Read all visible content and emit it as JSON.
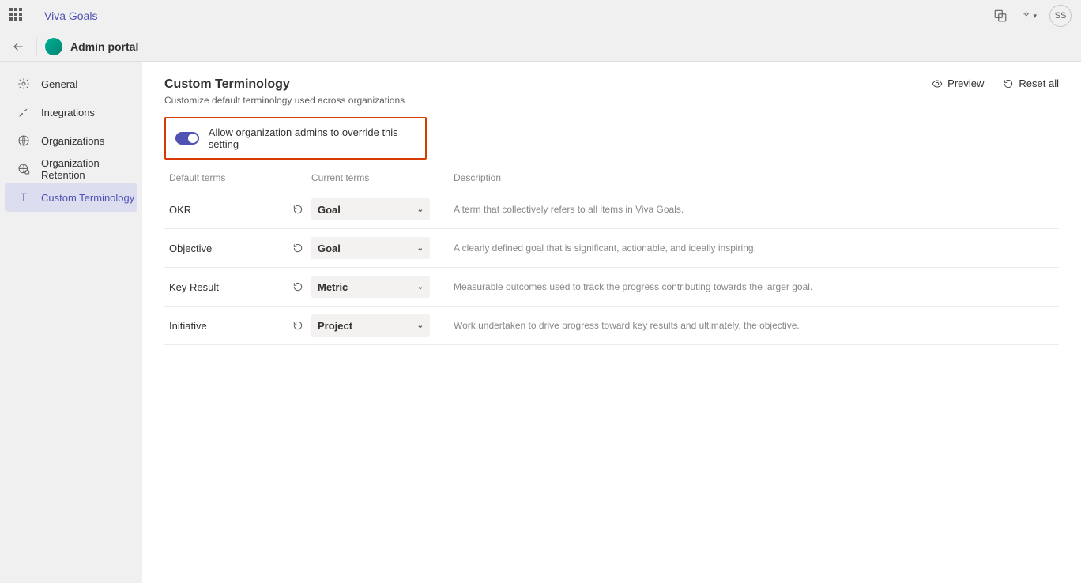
{
  "topbar": {
    "product": "Viva Goals",
    "avatar_initials": "SS"
  },
  "header": {
    "portal_title": "Admin portal"
  },
  "sidebar": {
    "items": [
      {
        "label": "General"
      },
      {
        "label": "Integrations"
      },
      {
        "label": "Organizations"
      },
      {
        "label": "Organization Retention"
      },
      {
        "label": "Custom Terminology"
      }
    ]
  },
  "page": {
    "title": "Custom Terminology",
    "subtitle": "Customize default terminology used across organizations",
    "preview_label": "Preview",
    "reset_label": "Reset all",
    "override_label": "Allow organization admins to override this setting"
  },
  "table": {
    "headers": {
      "default": "Default terms",
      "current": "Current terms",
      "description": "Description"
    },
    "rows": [
      {
        "default": "OKR",
        "current": "Goal",
        "description": "A term that collectively refers to all items in Viva Goals."
      },
      {
        "default": "Objective",
        "current": "Goal",
        "description": "A clearly defined goal that is significant, actionable, and ideally inspiring."
      },
      {
        "default": "Key Result",
        "current": "Metric",
        "description": "Measurable outcomes used to track the progress contributing towards the larger goal."
      },
      {
        "default": "Initiative",
        "current": "Project",
        "description": "Work undertaken to drive progress toward key results and ultimately, the objective."
      }
    ]
  }
}
